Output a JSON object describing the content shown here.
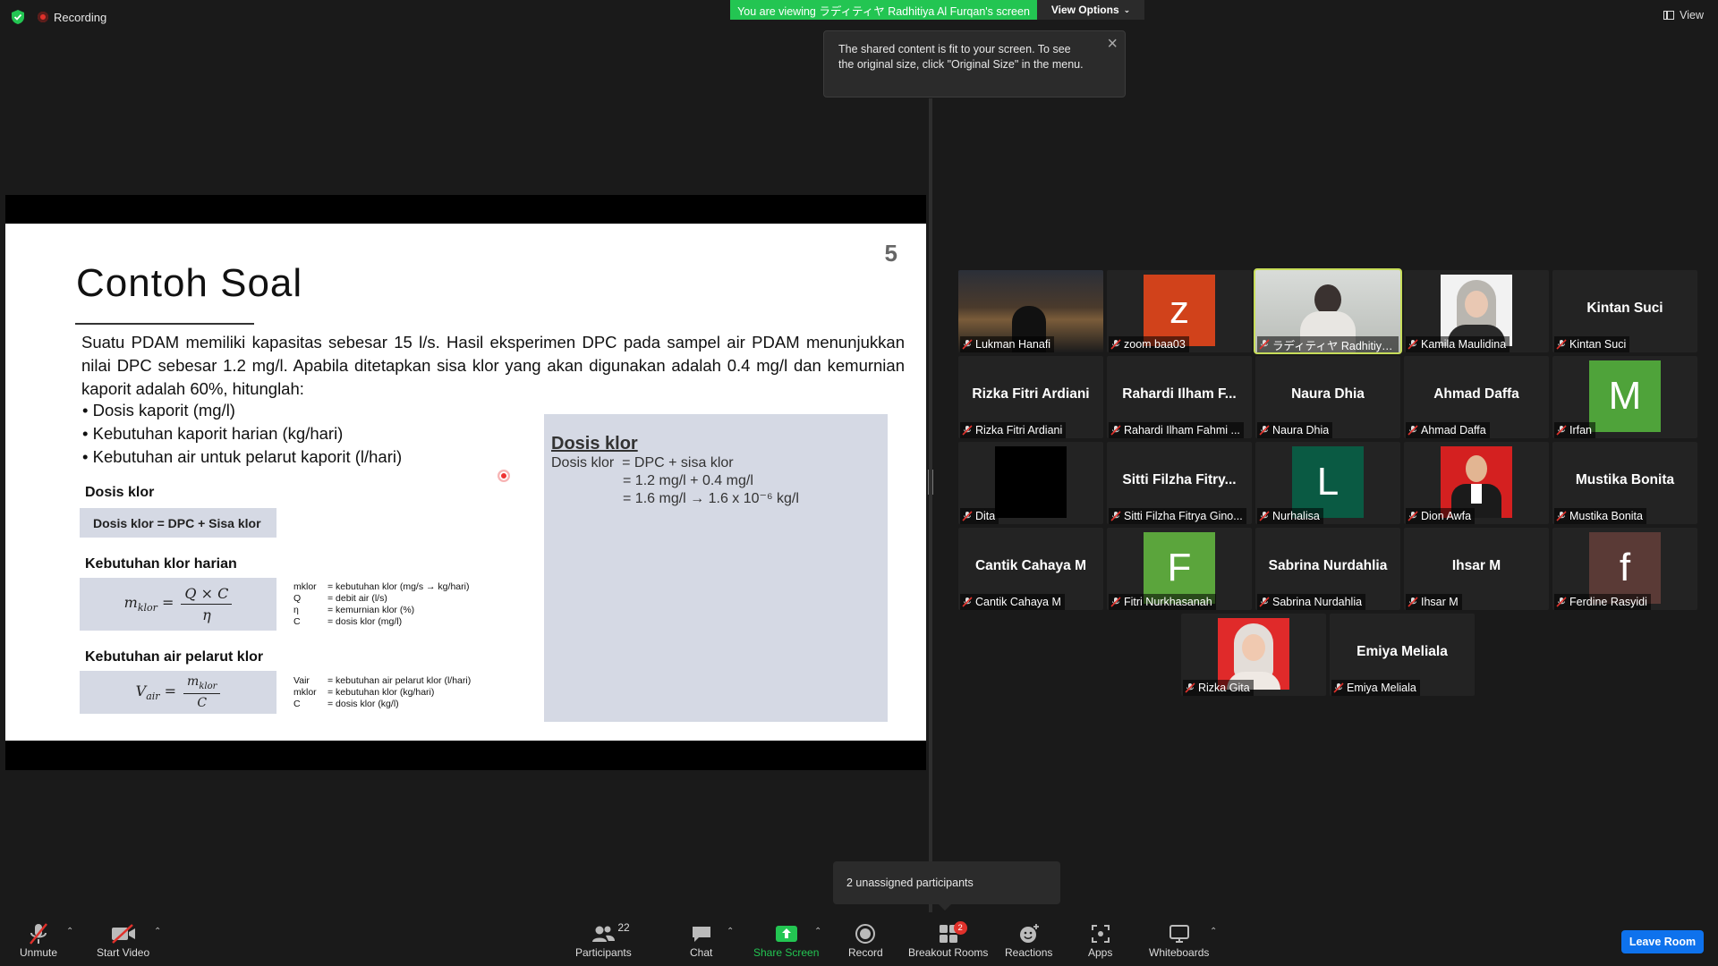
{
  "top": {
    "recording": "Recording",
    "viewing_banner": "You are viewing ラディティヤ Radhitiya Al Furqan's screen",
    "view_options": "View Options",
    "tooltip": "The shared content is fit to your screen. To see the original size, click \"Original Size\" in the menu.",
    "view": "View"
  },
  "slide": {
    "number": "5",
    "title": "Contoh Soal",
    "problem": "Suatu PDAM memiliki kapasitas sebesar 15 l/s. Hasil eksperimen DPC pada sampel air PDAM menunjukkan nilai DPC sebesar 1.2 mg/l. Apabila ditetapkan sisa klor yang akan digunakan adalah 0.4 mg/l dan kemurnian kaporit adalah 60%, hitunglah:",
    "bullets": [
      "Dosis kaporit (mg/l)",
      "Kebutuhan kaporit harian (kg/hari)",
      "Kebutuhan air untuk pelarut kaporit (l/hari)"
    ],
    "sec1": "Dosis klor",
    "formula1": "Dosis klor = DPC + Sisa klor",
    "sec2": "Kebutuhan klor harian",
    "f2_lhs": "m",
    "f2_sub": "klor",
    "f2_num": "Q × C",
    "f2_den": "η",
    "legend2": [
      {
        "k": "mklor",
        "v": "= kebutuhan klor (mg/s → kg/hari)"
      },
      {
        "k": "Q",
        "v": "= debit air (l/s)"
      },
      {
        "k": "η",
        "v": "= kemurnian klor (%)"
      },
      {
        "k": "C",
        "v": "= dosis klor (mg/l)"
      }
    ],
    "sec3": "Kebutuhan air pelarut klor",
    "f3_lhs": "V",
    "f3_sub": "air",
    "f3_num": "m",
    "f3_num_sub": "klor",
    "f3_den": "C",
    "legend3": [
      {
        "k": "Vair",
        "v": "= kebutuhan air pelarut klor (l/hari)"
      },
      {
        "k": "mklor",
        "v": "= kebutuhan klor (kg/hari)"
      },
      {
        "k": "C",
        "v": "= dosis klor (kg/l)"
      }
    ],
    "answer": {
      "title": "Dosis klor",
      "line1": "Dosis klor  = DPC + sisa klor",
      "line2": "                  = 1.2 mg/l + 0.4 mg/l",
      "line3": "                  = 1.6 mg/l → 1.6 x 10⁻⁶ kg/l"
    }
  },
  "participants": [
    {
      "name": "Lukman Hanafi",
      "center": "",
      "type": "photo-city"
    },
    {
      "name": "zoom baa03",
      "center": "",
      "type": "letter",
      "letter": "z",
      "color": "#d1421b"
    },
    {
      "name": "ラディティヤ Radhitiya Al F...",
      "center": "",
      "type": "photo-room",
      "active": true
    },
    {
      "name": "Kamila Maulidina",
      "center": "",
      "type": "photo-hijab"
    },
    {
      "name": "Kintan Suci",
      "center": "Kintan Suci",
      "type": "text"
    },
    {
      "name": "Rizka Fitri Ardiani",
      "center": "Rizka Fitri Ardiani",
      "type": "text"
    },
    {
      "name": "Rahardi Ilham Fahmi ...",
      "center": "Rahardi Ilham F...",
      "type": "text"
    },
    {
      "name": "Naura Dhia",
      "center": "Naura Dhia",
      "type": "text"
    },
    {
      "name": "Ahmad Daffa",
      "center": "Ahmad Daffa",
      "type": "text"
    },
    {
      "name": "Irfan",
      "center": "",
      "type": "letter",
      "letter": "M",
      "color": "#4fa33a"
    },
    {
      "name": "Dita",
      "center": "",
      "type": "black"
    },
    {
      "name": "Sitti Filzha Fitrya Gino...",
      "center": "Sitti Filzha Fitry...",
      "type": "text"
    },
    {
      "name": "Nurhalisa",
      "center": "",
      "type": "letter",
      "letter": "L",
      "color": "#0a5a43"
    },
    {
      "name": "Dion Awfa",
      "center": "",
      "type": "photo-suit"
    },
    {
      "name": "Mustika Bonita",
      "center": "Mustika Bonita",
      "type": "text"
    },
    {
      "name": "Cantik Cahaya M",
      "center": "Cantik Cahaya M",
      "type": "text"
    },
    {
      "name": "Fitri Nurkhasanah",
      "center": "",
      "type": "letter",
      "letter": "F",
      "color": "#5ba53c"
    },
    {
      "name": "Sabrina Nurdahlia",
      "center": "Sabrina Nurdahlia",
      "type": "text"
    },
    {
      "name": "Ihsar M",
      "center": "Ihsar M",
      "type": "text"
    },
    {
      "name": "Ferdine Rasyidi",
      "center": "",
      "type": "letter",
      "letter": "f",
      "color": "#5a3a36"
    },
    {
      "name": "Rizka Gita",
      "center": "",
      "type": "photo-red"
    },
    {
      "name": "Emiya Meliala",
      "center": "Emiya Meliala",
      "type": "text"
    }
  ],
  "bottom": {
    "unassigned": "2 unassigned participants",
    "unmute": "Unmute",
    "start_video": "Start Video",
    "participants": "Participants",
    "participants_count": "22",
    "chat": "Chat",
    "share_screen": "Share Screen",
    "record": "Record",
    "breakout_rooms": "Breakout Rooms",
    "breakout_badge": "2",
    "reactions": "Reactions",
    "apps": "Apps",
    "whiteboards": "Whiteboards",
    "leave_room": "Leave Room"
  }
}
